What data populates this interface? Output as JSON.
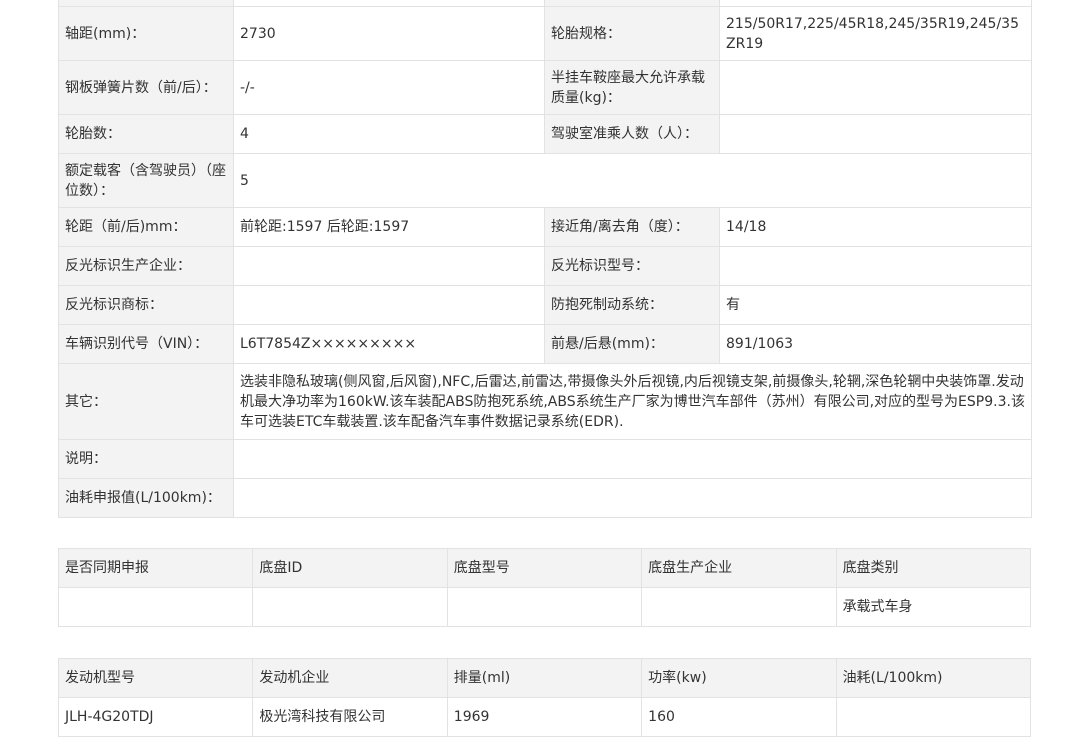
{
  "spec": {
    "wheelbase_label": "轴距(mm)：",
    "wheelbase_value": "2730",
    "tire_spec_label": "轮胎规格：",
    "tire_spec_value": "215/50R17,225/45R18,245/35R19,245/35ZR19",
    "leaf_spring_label": "钢板弹簧片数（前/后）：",
    "leaf_spring_value": "-/-",
    "semitrailer_label": "半挂车鞍座最大允许承载质量(kg)：",
    "semitrailer_value": "",
    "tire_count_label": "轮胎数：",
    "tire_count_value": "4",
    "cab_seats_label": "驾驶室准乘人数（人）：",
    "cab_seats_value": "",
    "passengers_label": "额定载客（含驾驶员）（座位数）：",
    "passengers_value": "5",
    "track_label": "轮距（前/后)mm：",
    "track_value": "前轮距:1597 后轮距:1597",
    "angle_label": "接近角/离去角（度）：",
    "angle_value": "14/18",
    "reflective_maker_label": "反光标识生产企业：",
    "reflective_maker_value": "",
    "reflective_model_label": "反光标识型号：",
    "reflective_model_value": "",
    "reflective_brand_label": "反光标识商标：",
    "reflective_brand_value": "",
    "abs_label": "防抱死制动系统：",
    "abs_value": "有",
    "vin_label": "车辆识别代号（VIN）：",
    "vin_value": "L6T7854Z×××××××××",
    "overhang_label": "前悬/后悬(mm)：",
    "overhang_value": "891/1063",
    "other_label": "其它：",
    "other_value": "选装非隐私玻璃(侧风窗,后风窗),NFC,后雷达,前雷达,带摄像头外后视镜,内后视镜支架,前摄像头,轮辋,深色轮辋中央装饰罩.发动机最大净功率为160kW.该车装配ABS防抱死系统,ABS系统生产厂家为博世汽车部件（苏州）有限公司,对应的型号为ESP9.3.该车可选装ETC车载装置.该车配备汽车事件数据记录系统(EDR).",
    "notes_label": "说明：",
    "notes_value": "",
    "fuel_label": "油耗申报值(L/100km)：",
    "fuel_value": ""
  },
  "chassis": {
    "headers": [
      "是否同期申报",
      "底盘ID",
      "底盘型号",
      "底盘生产企业",
      "底盘类别"
    ],
    "row": [
      "",
      "",
      "",
      "",
      "承载式车身"
    ]
  },
  "engine": {
    "headers": [
      "发动机型号",
      "发动机企业",
      "排量(ml)",
      "功率(kw)",
      "油耗(L/100km)"
    ],
    "row": [
      "JLH-4G20TDJ",
      "极光湾科技有限公司",
      "1969",
      "160",
      ""
    ]
  }
}
